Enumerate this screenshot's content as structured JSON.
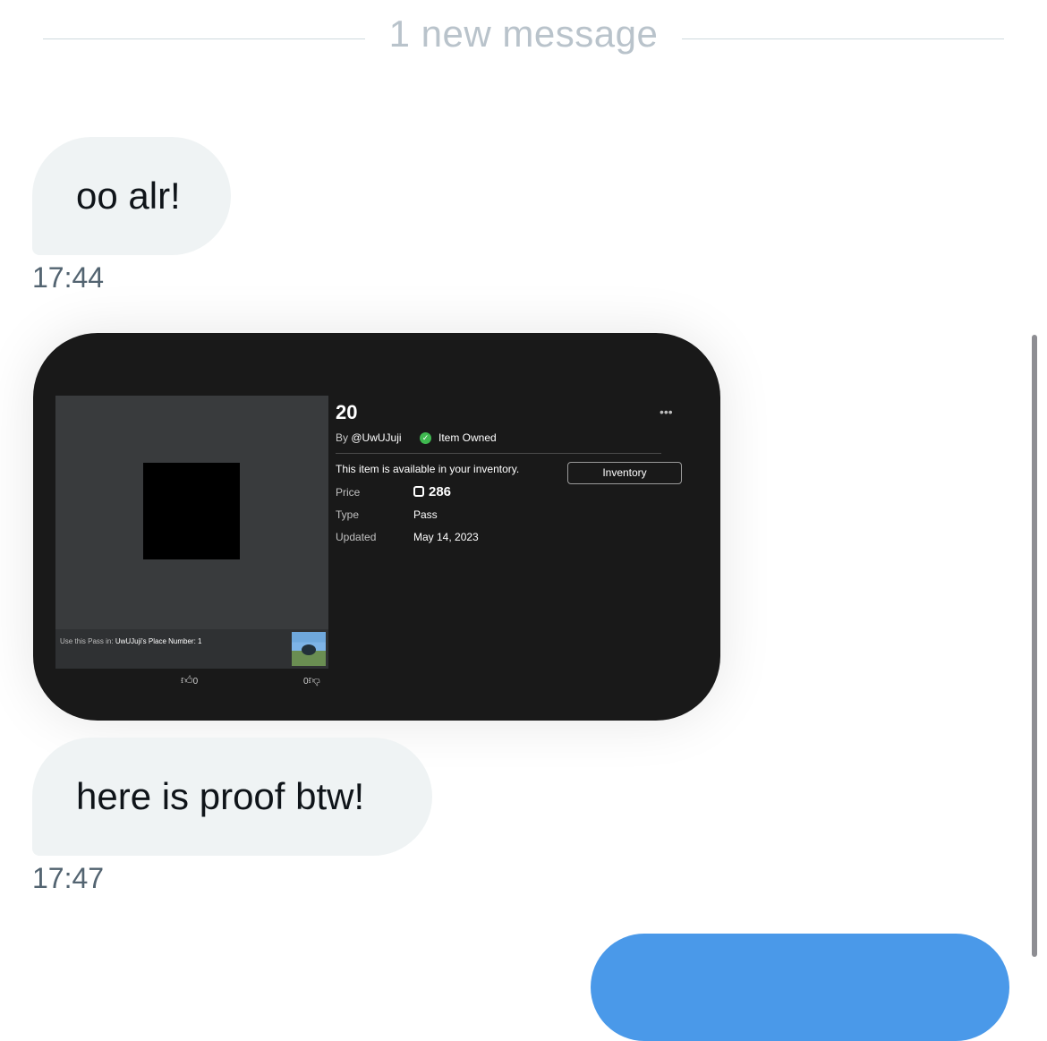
{
  "divider": {
    "text": "1 new message"
  },
  "messages": [
    {
      "text": "oo alr!",
      "time": "17:44"
    },
    {
      "text": "here is proof btw!",
      "time": "17:47"
    }
  ],
  "item_card": {
    "title": "20",
    "by_prefix": "By",
    "creator": "@UwUJuji",
    "owned_label": "Item Owned",
    "more_icon": "•••",
    "availability": "This item is available in your inventory.",
    "inventory_button": "Inventory",
    "price_label": "Price",
    "price_value": "286",
    "type_label": "Type",
    "type_value": "Pass",
    "updated_label": "Updated",
    "updated_value": "May 14, 2023",
    "use_pass_prefix": "Use this Pass in:",
    "use_pass_place": "UwUJuji's Place Number: 1",
    "upvotes": "0",
    "downvotes": "0"
  },
  "colors": {
    "accent_blue": "#4a99e9",
    "bubble_bg": "#eff3f4",
    "card_bg": "#191919",
    "owned_green": "#3fb950"
  }
}
